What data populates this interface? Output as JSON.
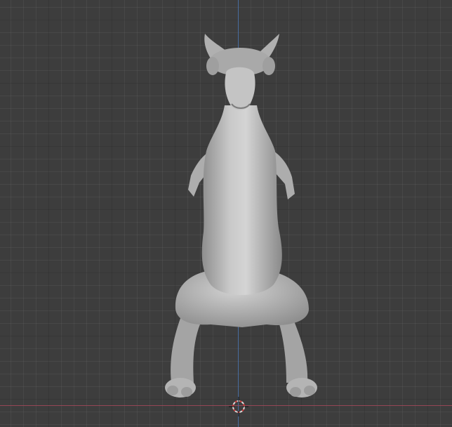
{
  "viewport": {
    "background_color": "#3d3d3d",
    "axis_x_color": "#a5485a",
    "axis_z_color": "#4f7fc4",
    "model_icon": "dragon-sculpt-mesh",
    "cursor_icon": "3d-cursor-icon"
  }
}
